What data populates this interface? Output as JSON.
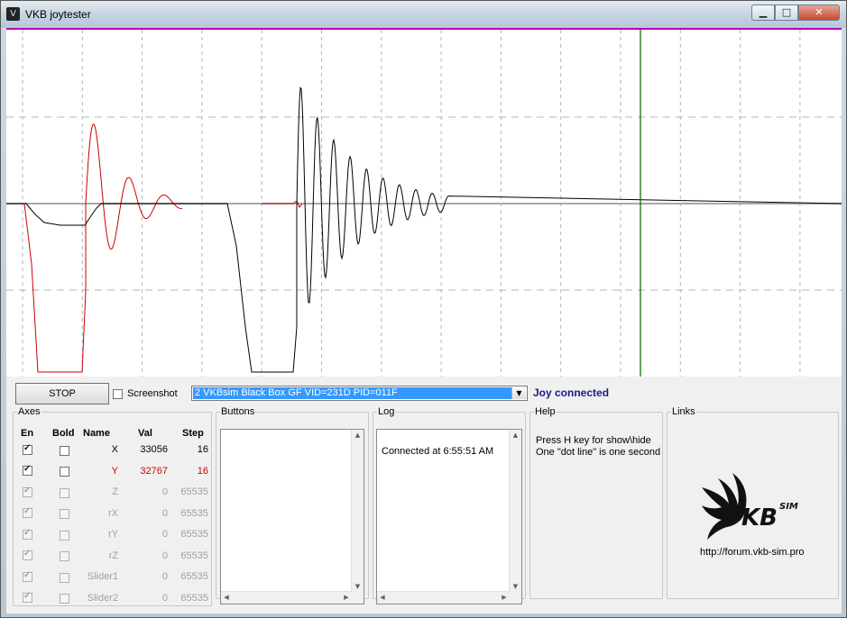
{
  "window": {
    "title": "VKB joytester",
    "controls": {
      "minimize": "▁",
      "maximize": "□",
      "close": "✕"
    }
  },
  "toolbar": {
    "stop_label": "STOP",
    "screenshot_label": "Screenshot",
    "screenshot_checked": false,
    "device_selected": "2 VKBsim Black Box GF  VID=231D PID=011F",
    "status": "Joy connected",
    "status_color": "#1a1a8a"
  },
  "colors": {
    "graph_top_border": "#b400b4",
    "trace_x": "#000000",
    "trace_y": "#cc0000",
    "cursor": "#006400",
    "grid": "#b4b4b4"
  },
  "axes": {
    "legend": "Axes",
    "headers": {
      "en": "En",
      "bold": "Bold",
      "name": "Name",
      "val": "Val",
      "step": "Step"
    },
    "rows": [
      {
        "name": "X",
        "val": "33056",
        "step": "16",
        "en": true,
        "bold": false,
        "enabled": true,
        "color": "#000000"
      },
      {
        "name": "Y",
        "val": "32767",
        "step": "16",
        "en": true,
        "bold": false,
        "enabled": true,
        "color": "#d40000"
      },
      {
        "name": "Z",
        "val": "0",
        "step": "65535",
        "en": true,
        "bold": false,
        "enabled": false
      },
      {
        "name": "rX",
        "val": "0",
        "step": "65535",
        "en": true,
        "bold": false,
        "enabled": false
      },
      {
        "name": "rY",
        "val": "0",
        "step": "65535",
        "en": true,
        "bold": false,
        "enabled": false
      },
      {
        "name": "rZ",
        "val": "0",
        "step": "65535",
        "en": true,
        "bold": false,
        "enabled": false
      },
      {
        "name": "Slider1",
        "val": "0",
        "step": "65535",
        "en": true,
        "bold": false,
        "enabled": false
      },
      {
        "name": "Slider2",
        "val": "0",
        "step": "65535",
        "en": true,
        "bold": false,
        "enabled": false
      }
    ]
  },
  "buttons_panel": {
    "legend": "Buttons"
  },
  "log_panel": {
    "legend": "Log",
    "lines": [
      "Connected at 6:55:51 AM"
    ]
  },
  "help_panel": {
    "legend": "Help",
    "line1": "Press H key for show\\hide",
    "line2": "One \"dot line\" is one second"
  },
  "links_panel": {
    "legend": "Links",
    "logo_text": "VKBSIM",
    "url": "http://forum.vkb-sim.pro"
  }
}
